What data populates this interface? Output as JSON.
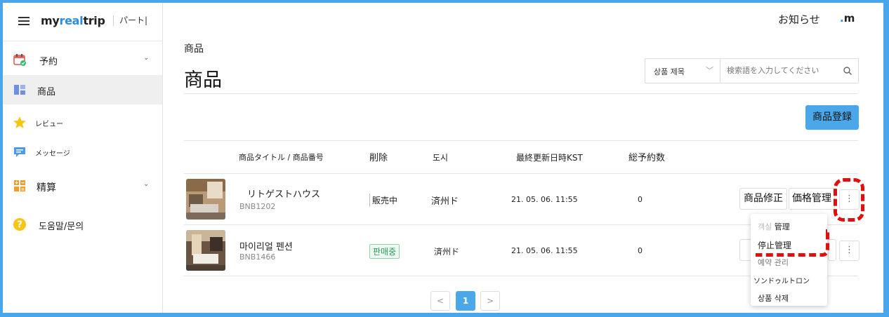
{
  "sidebar": {
    "logo_prefix": "my",
    "logo_accent": "real",
    "logo_suffix": "trip",
    "partner_label": "パート|",
    "items": [
      {
        "label": "予約",
        "icon": "calendar-icon"
      },
      {
        "label": "商品",
        "icon": "product-grid-icon"
      },
      {
        "label": "レビュー",
        "icon": "star-icon"
      },
      {
        "label": "メッセージ",
        "icon": "chat-bubble-icon"
      },
      {
        "label": "精算",
        "icon": "calculator-icon"
      },
      {
        "label": "도움말/문의",
        "icon": "help-circle-icon"
      }
    ]
  },
  "header": {
    "notice_label": "お知らせ",
    "brand_mark_dot": ".",
    "brand_mark_letter": "m"
  },
  "main": {
    "breadcrumb": "商品",
    "title": "商品",
    "search": {
      "select_value": "상품 제목",
      "placeholder": "検索語を入力してください"
    },
    "register_button": "商品登録",
    "columns": [
      "商品タイトル / 商品番号",
      "削除",
      "도시",
      "最終更新日時KST",
      "総予約数"
    ],
    "rows": [
      {
        "title": "リトゲストハウス",
        "code": "BNB1202",
        "status": "販売中",
        "city": "済州ド",
        "updated": "21. 05. 06. 11:55",
        "bookings": "0",
        "edit_label": "商品修正",
        "price_label": "価格管理"
      },
      {
        "title": "마이리얼 펜션",
        "code": "BNB1466",
        "status": "판매중",
        "city": "済州ド",
        "updated": "21. 05. 06. 11:55",
        "bookings": "0"
      }
    ],
    "dropdown": {
      "item1_faded": "객실",
      "item1_text": " 管理",
      "item2": "停止管理",
      "item3": "예약 관리",
      "item4": "ソンドゥルトロン",
      "item5": "상품 삭제"
    },
    "pagination": {
      "prev": "<",
      "current": "1",
      "next": ">"
    }
  },
  "colors": {
    "accent": "#4aa8ea",
    "annotation": "#e01010",
    "status_green": "#2a9a5a"
  }
}
